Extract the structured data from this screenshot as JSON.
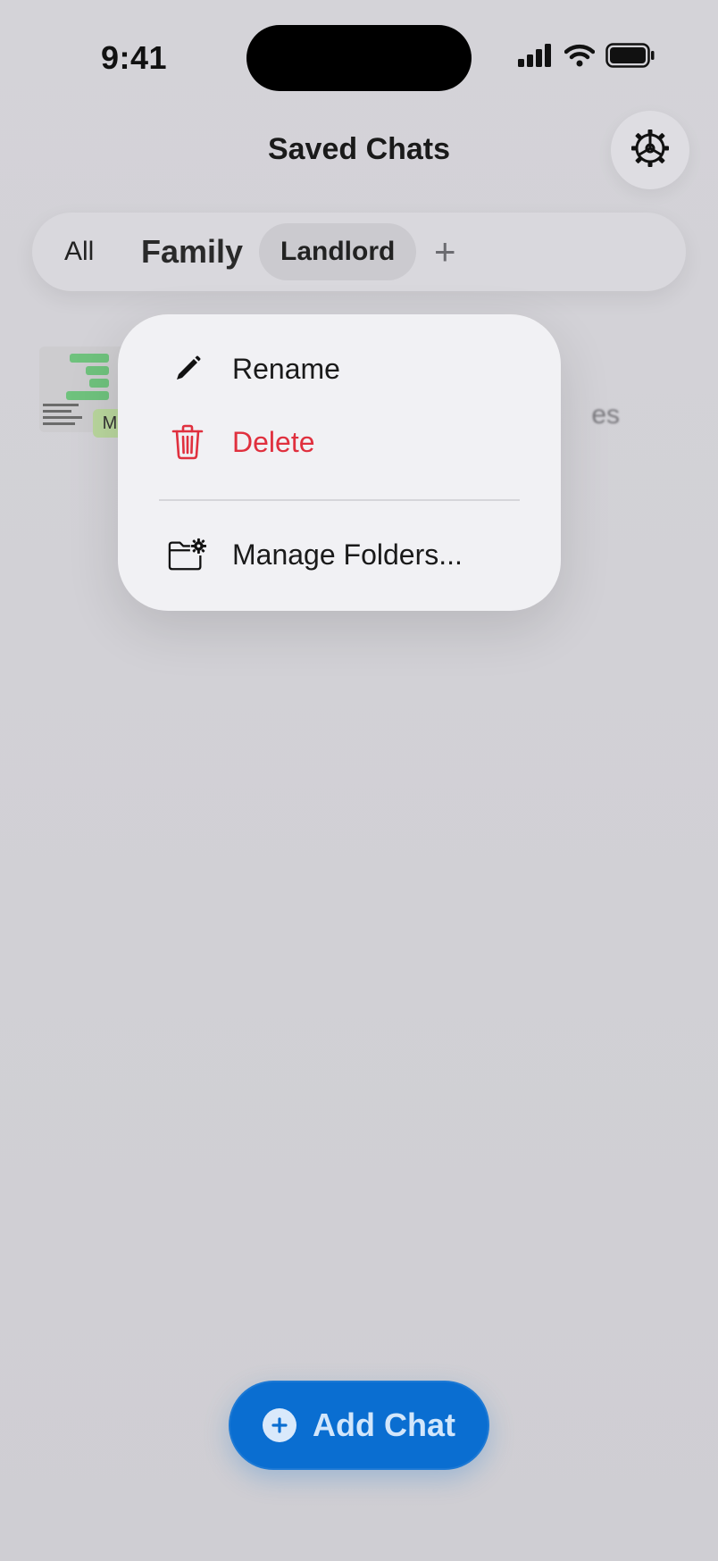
{
  "status_bar": {
    "time": "9:41",
    "icons": [
      "cellular-signal-icon",
      "wifi-icon",
      "battery-icon"
    ]
  },
  "header": {
    "title": "Saved Chats",
    "settings_icon": "gear-icon"
  },
  "tabs": [
    {
      "label": "All"
    },
    {
      "label": "Family"
    },
    {
      "label": "Landlord",
      "selected": true
    },
    {
      "label": "+"
    }
  ],
  "list": {
    "items": [
      {
        "thumbnail_badge": "M",
        "preview_text": "es"
      }
    ]
  },
  "context_menu": {
    "items": [
      {
        "label": "Rename",
        "icon": "pencil-icon"
      },
      {
        "label": "Delete",
        "icon": "trash-icon",
        "color": "#e0303e"
      },
      {
        "label": "Manage Folders...",
        "icon": "folder-gear-icon"
      }
    ]
  },
  "add_chat": {
    "label": "Add Chat",
    "icon": "plus-circle-icon",
    "color": "#0a6ed1"
  }
}
